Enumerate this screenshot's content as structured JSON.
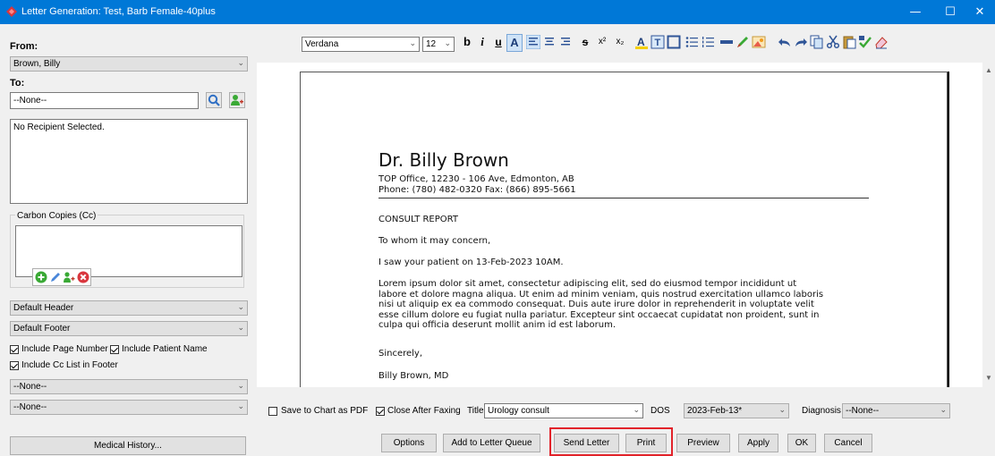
{
  "window": {
    "title": "Letter Generation: Test, Barb Female-40plus",
    "minimize": "—",
    "maximize": "☐",
    "close": "✕"
  },
  "left": {
    "from_label": "From:",
    "from_value": "Brown, Billy",
    "to_label": "To:",
    "to_value": "--None--",
    "recipient_text": "No Recipient Selected.",
    "cc_label": "Carbon Copies (Cc)",
    "header_select": "Default Header",
    "footer_select": "Default Footer",
    "include_page_number": "Include Page Number",
    "include_patient_name": "Include Patient Name",
    "include_cc_list": "Include Cc List in Footer",
    "none_select_1": "--None--",
    "none_select_2": "--None--",
    "medical_history_button": "Medical History..."
  },
  "toolbar": {
    "font_family": "Verdana",
    "font_size": "12",
    "bold": "b",
    "italic": "i",
    "underline": "u",
    "font_color": "A",
    "strike": "s",
    "superscript": "x²",
    "subscript": "x₂"
  },
  "document": {
    "doctor_name": "Dr. Billy Brown",
    "address": "TOP Office, 12230 - 106 Ave, Edmonton, AB",
    "phone": "Phone: (780) 482-0320 Fax: (866) 895-5661",
    "report_title": "CONSULT REPORT",
    "greeting": "To whom it may concern,",
    "intro": "I saw your patient on 13-Feb-2023 10AM.",
    "body_lines": [
      "Lorem ipsum dolor sit amet, consectetur adipiscing elit, sed do eiusmod tempor incididunt ut",
      "labore et dolore magna aliqua. Ut enim ad minim veniam, quis nostrud exercitation ullamco laboris",
      "nisi ut aliquip ex ea commodo consequat. Duis aute irure dolor in reprehenderit in voluptate velit",
      "esse cillum dolore eu fugiat nulla pariatur. Excepteur sint occaecat cupidatat non proident, sunt in",
      "culpa qui officia deserunt mollit anim id est laborum."
    ],
    "closing": "Sincerely,",
    "signature": "Billy Brown, MD"
  },
  "bottom": {
    "save_pdf": "Save to Chart as PDF",
    "close_after_faxing": "Close After Faxing",
    "title_label": "Title",
    "title_value": "Urology consult",
    "dos_label": "DOS",
    "dos_value": "2023-Feb-13*",
    "diagnosis_label": "Diagnosis",
    "diagnosis_value": "--None--"
  },
  "buttons": {
    "options": "Options",
    "add_queue": "Add to Letter Queue",
    "send_letter": "Send Letter",
    "print": "Print",
    "preview": "Preview",
    "apply": "Apply",
    "ok": "OK",
    "cancel": "Cancel"
  },
  "colors": {
    "titlebar": "#0078d7",
    "highlight": "#e2232a",
    "green_icon": "#3aa935"
  }
}
